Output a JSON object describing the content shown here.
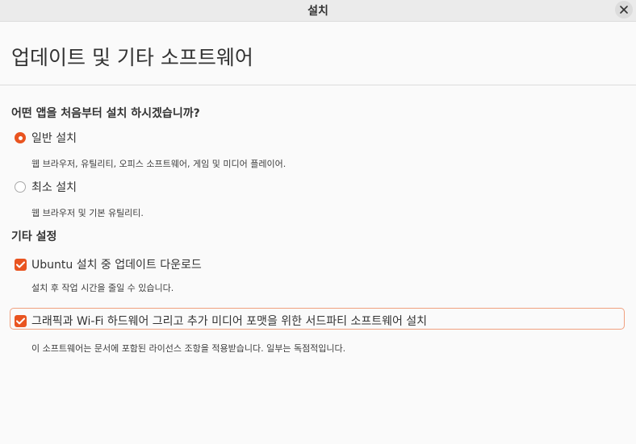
{
  "window": {
    "title": "설치"
  },
  "page": {
    "title": "업데이트 및 기타 소프트웨어"
  },
  "install_type": {
    "question": "어떤 앱을 처음부터 설치 하시겠습니까?",
    "options": [
      {
        "label": "일반 설치",
        "description": "웹 브라우저, 유틸리티, 오피스  소프트웨어, 게임 및 미디어 플레이어.",
        "selected": true
      },
      {
        "label": "최소 설치",
        "description": "웹 브라우저 및 기본 유틸리티.",
        "selected": false
      }
    ]
  },
  "other_settings": {
    "heading": "기타 설정",
    "items": [
      {
        "label": "Ubuntu 설치 중 업데이트 다운로드",
        "description": "설치 후 작업 시간을 줄일 수 있습니다.",
        "checked": true
      },
      {
        "label": "그래픽과 Wi-Fi 하드웨어 그리고 추가 미디어 포맷을 위한 서드파티 소프트웨어 설치",
        "description": "이 소프트웨어는 문서에 포함된 라이선스 조항을 적용받습니다. 일부는 독점적입니다.",
        "checked": true,
        "focused": true
      }
    ]
  },
  "colors": {
    "accent": "#e95420",
    "focus_ring": "#f0a07f",
    "background": "#fafafa",
    "titlebar": "#ebebeb"
  },
  "icons": {
    "close": "close-icon",
    "check": "checkmark-icon"
  }
}
